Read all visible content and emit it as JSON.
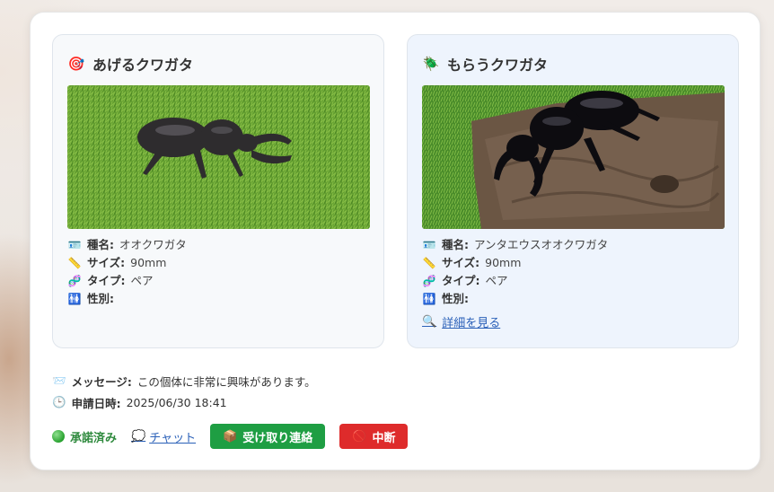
{
  "give": {
    "icon": "target-icon",
    "title": "あげるクワガタ",
    "photo_icon": "stag-beetle-on-grass",
    "species_label": "種名:",
    "species": "オオクワガタ",
    "size_label": "サイズ:",
    "size": "90mm",
    "type_label": "タイプ:",
    "type": "ペア",
    "gender_label": "性別:",
    "gender": ""
  },
  "get": {
    "icon": "beetle-icon",
    "title": "もらうクワガタ",
    "photo_icon": "stag-beetle-on-bark",
    "species_label": "種名:",
    "species": "アンタエウスオオクワガタ",
    "size_label": "サイズ:",
    "size": "90mm",
    "type_label": "タイプ:",
    "type": "ペア",
    "gender_label": "性別:",
    "gender": "",
    "detail_link": "詳細を見る"
  },
  "meta": {
    "message_label": "メッセージ:",
    "message": "この個体に非常に興味があります。",
    "date_label": "申請日時:",
    "date": "2025/06/30 18:41"
  },
  "actions": {
    "status": "承諾済み",
    "status_color": "#2f8a3e",
    "chat": "チャット",
    "receive": "受け取り連絡",
    "receive_color": "#1e9e43",
    "cancel": "中断",
    "cancel_color": "#de2b2b"
  }
}
